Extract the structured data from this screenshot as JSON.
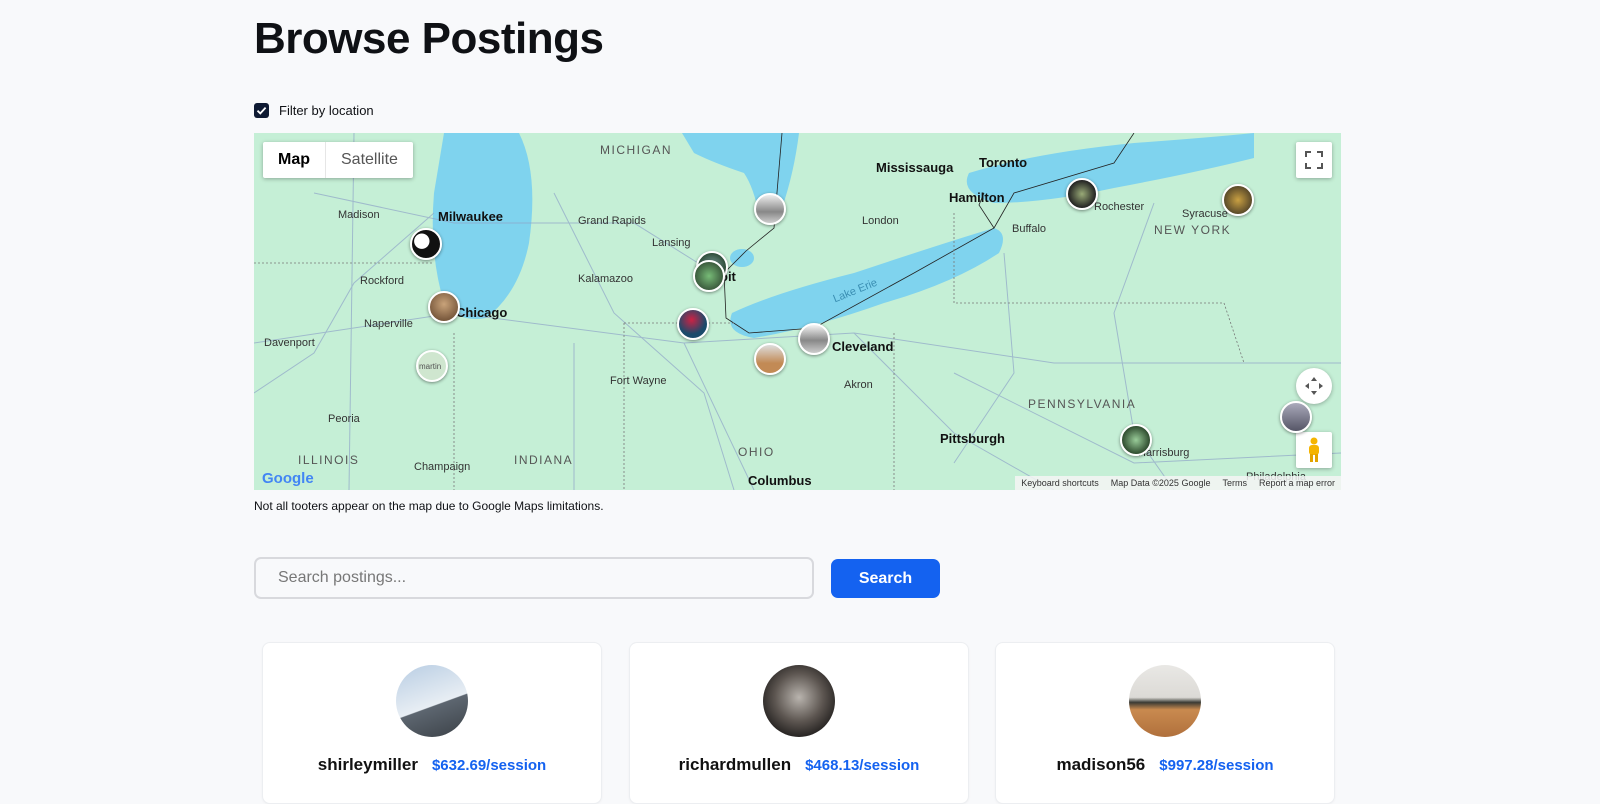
{
  "page": {
    "title": "Browse Postings"
  },
  "filter": {
    "label": "Filter by location",
    "checked": true
  },
  "map": {
    "type_controls": {
      "map": "Map",
      "satellite": "Satellite",
      "selected": "Map"
    },
    "labels": {
      "michigan": "MICHIGAN",
      "mississauga": "Mississauga",
      "toronto": "Toronto",
      "hamilton": "Hamilton",
      "rochester": "Rochester",
      "syracuse": "Syracuse",
      "new_york": "NEW YORK",
      "madison": "Madison",
      "milwaukee": "Milwaukee",
      "grand_rapids": "Grand Rapids",
      "london": "London",
      "buffalo": "Buffalo",
      "lansing": "Lansing",
      "rockford": "Rockford",
      "kalamazoo": "Kalamazoo",
      "detroit": "Detroit",
      "lake_erie": "Lake Erie",
      "naperville": "Naperville",
      "chicago": "Chicago",
      "davenport": "Davenport",
      "cleveland": "Cleveland",
      "fort_wayne": "Fort Wayne",
      "akron": "Akron",
      "pennsylvania": "PENNSYLVANIA",
      "peoria": "Peoria",
      "ohio": "OHIO",
      "pittsburgh": "Pittsburgh",
      "illinois": "ILLINOIS",
      "indiana": "INDIANA",
      "harrisburg": "Harrisburg",
      "champaign": "Champaign",
      "columbus": "Columbus",
      "philadelphia": "Philadelphia"
    },
    "marker_alt": "martin",
    "attribution": {
      "shortcuts": "Keyboard shortcuts",
      "data": "Map Data ©2025 Google",
      "terms": "Terms",
      "report": "Report a map error"
    },
    "logo": "Google"
  },
  "note": "Not all tooters appear on the map due to Google Maps limitations.",
  "search": {
    "placeholder": "Search postings...",
    "button_label": "Search"
  },
  "postings": [
    {
      "username": "shirleymiller",
      "price": "$632.69/session"
    },
    {
      "username": "richardmullen",
      "price": "$468.13/session"
    },
    {
      "username": "madison56",
      "price": "$997.28/session"
    }
  ],
  "colors": {
    "accent": "#1462f0",
    "water": "#7fd3ee",
    "land": "#c5efd6"
  }
}
